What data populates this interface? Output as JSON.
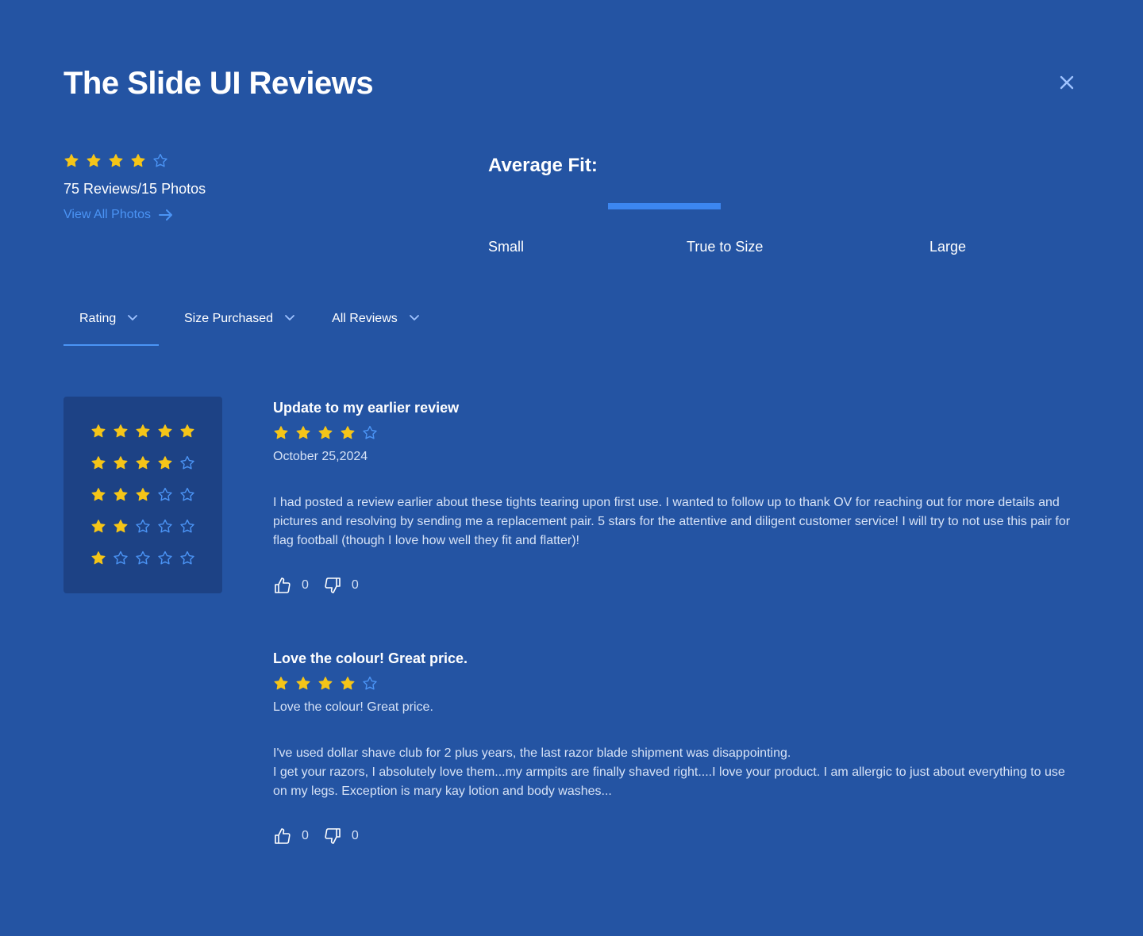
{
  "header": {
    "title": "The Slide UI Reviews"
  },
  "colors": {
    "background": "#2454a3",
    "star_filled": "#f5c518",
    "star_empty": "#4b94f5",
    "link": "#4b94f5",
    "panel": "#1d4285"
  },
  "icons": {
    "close": "close-icon",
    "star_filled": "star-filled-icon",
    "star_empty": "star-outline-icon",
    "arrow": "arrow-right-icon",
    "chevron": "chevron-down-icon",
    "thumbs_up": "thumbs-up-icon",
    "thumbs_down": "thumbs-down-icon"
  },
  "summary": {
    "rating": 4,
    "max_rating": 5,
    "count_text": "75 Reviews/15 Photos",
    "view_photos_label": "View All Photos"
  },
  "fit": {
    "title": "Average Fit:",
    "labels": [
      "Small",
      "True to Size",
      "Large"
    ],
    "value_label": "True to Size"
  },
  "filters": [
    {
      "label": "Rating",
      "active": true
    },
    {
      "label": "Size Purchased",
      "active": false
    },
    {
      "label": "All Reviews",
      "active": false
    }
  ],
  "rating_filter_options": [
    5,
    4,
    3,
    2,
    1
  ],
  "reviews": [
    {
      "title": "Update to my earlier review",
      "rating": 4,
      "subtitle": "October 25,2024",
      "body": [
        "I had posted a review earlier about these tights tearing upon first use. I wanted to follow up to thank OV for reaching out for more details and pictures and resolving by sending me a replacement pair. 5 stars for the attentive and diligent customer service! I will try to not use this pair for flag football (though I love how well they fit and flatter)!"
      ],
      "helpful": "0",
      "not_helpful": "0"
    },
    {
      "title": "Love the colour! Great price.",
      "rating": 4,
      "subtitle": "Love the colour! Great price.",
      "body": [
        "I've used dollar shave club for 2 plus years, the last razor blade shipment was disappointing.",
        "I get your razors, I absolutely love them...my armpits are finally shaved right....I love your product. I am allergic to just about everything to use on my legs. Exception is mary kay lotion and body washes..."
      ],
      "helpful": "0",
      "not_helpful": "0"
    }
  ]
}
